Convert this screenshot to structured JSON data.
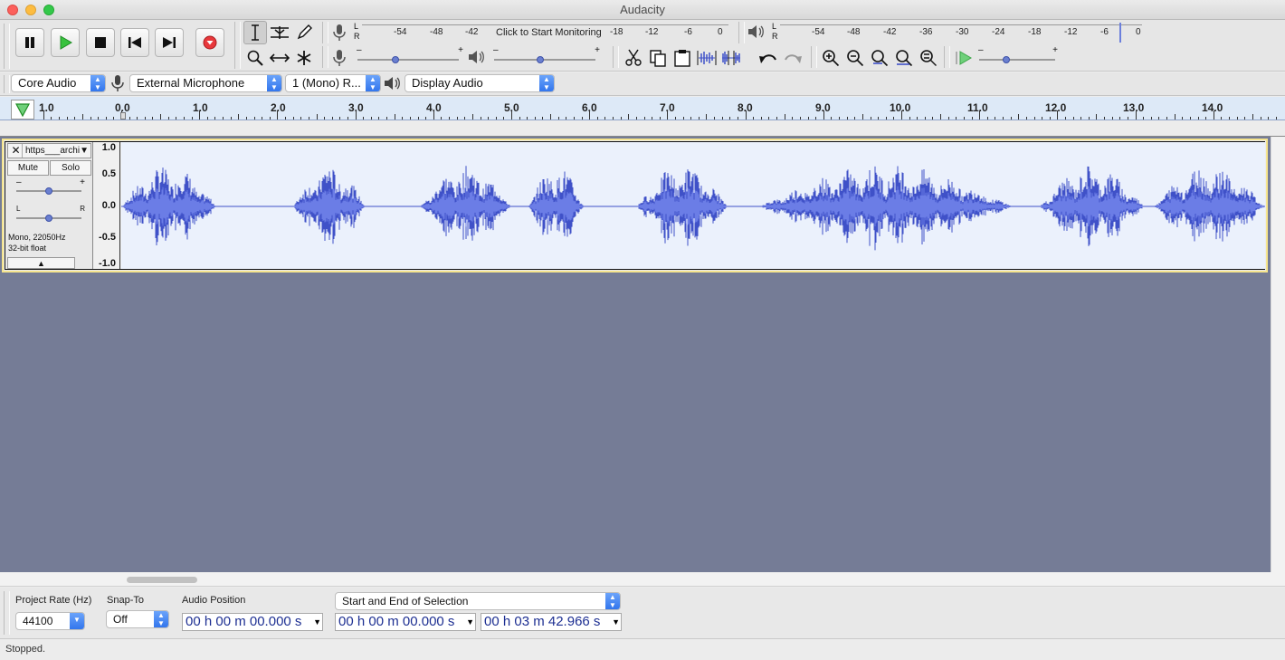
{
  "window": {
    "title": "Audacity"
  },
  "meters": {
    "record_ticks": [
      "-54",
      "-48",
      "-42",
      "-18",
      "-12",
      "-6",
      "0"
    ],
    "record_prompt": "Click to Start Monitoring",
    "playback_ticks": [
      "-54",
      "-48",
      "-42",
      "-36",
      "-30",
      "-24",
      "-18",
      "-12",
      "-6",
      "0"
    ],
    "channels": [
      "L",
      "R"
    ]
  },
  "devices": {
    "host": "Core Audio",
    "recording_device": "External Microphone",
    "recording_channels": "1 (Mono) R...",
    "playback_device": "Display Audio"
  },
  "ruler": {
    "labels": [
      "1.0",
      "0.0",
      "1.0",
      "2.0",
      "3.0",
      "4.0",
      "5.0",
      "6.0",
      "7.0",
      "8.0",
      "9.0",
      "10.0",
      "11.0",
      "12.0",
      "13.0",
      "14.0"
    ]
  },
  "track": {
    "name": "https___archi",
    "mute_label": "Mute",
    "solo_label": "Solo",
    "gain_minus": "–",
    "gain_plus": "+",
    "pan_left": "L",
    "pan_right": "R",
    "info_line1": "Mono, 22050Hz",
    "info_line2": "32-bit float",
    "scale": [
      "1.0",
      "0.5",
      "0.0",
      "-0.5",
      "-1.0"
    ],
    "wave_color": "#3f51c8",
    "wave_rms_color": "#6b7de6"
  },
  "selection_toolbar": {
    "project_rate_label": "Project Rate (Hz)",
    "project_rate_value": "44100",
    "snap_label": "Snap-To",
    "snap_value": "Off",
    "audio_position_label": "Audio Position",
    "selection_mode": "Start and End of Selection",
    "audio_position": "00 h 00 m 00.000 s",
    "selection_start": "00 h 00 m 00.000 s",
    "selection_end": "00 h 03 m 42.966 s"
  },
  "status": {
    "text": "Stopped."
  }
}
